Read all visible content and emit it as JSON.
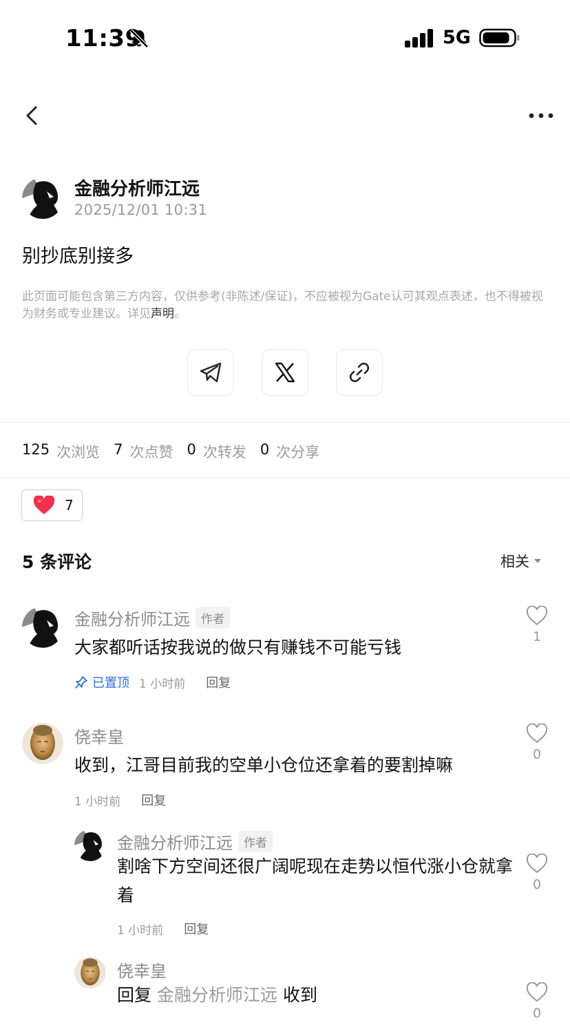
{
  "status_bar": {
    "time": "11:39",
    "network": "5G"
  },
  "post": {
    "author": "金融分析师江远",
    "time": "2025/12/01 10:31",
    "text": "别抄底别接多"
  },
  "disclaimer": {
    "text": "此页面可能包含第三方内容，仅供参考(非陈述/保证)，不应被视为Gate认可其观点表述，也不得被视为财务或专业建议。详见",
    "link": "声明",
    "end": "。"
  },
  "stats": {
    "views": "125",
    "views_label": "次浏览",
    "likes": "7",
    "likes_label": "次点赞",
    "reposts": "0",
    "reposts_label": "次转发",
    "shares": "0",
    "shares_label": "次分享"
  },
  "reaction": {
    "count": "7"
  },
  "comments_header": {
    "title": "5 条评论",
    "sort": "相关"
  },
  "comments": [
    {
      "name": "金融分析师江远",
      "badge": "作者",
      "text": "大家都听话按我说的做只有赚钱不可能亏钱",
      "pinned": "已置顶",
      "time": "1 小时前",
      "reply": "回复",
      "likes": "1"
    },
    {
      "name": "侥幸皇",
      "text": "收到，江哥目前我的空单小仓位还拿着的要割掉嘛",
      "time": "1 小时前",
      "reply": "回复",
      "likes": "0"
    },
    {
      "name": "金融分析师江远",
      "badge": "作者",
      "text": "割啥下方空间还很广阔呢现在走势以恒代涨小仓就拿着",
      "time": "1 小时前",
      "reply": "回复",
      "likes": "0"
    },
    {
      "name": "侥幸皇",
      "reply_prefix": "回复",
      "mention": "金融分析师江远",
      "text": "收到",
      "likes": "0"
    }
  ]
}
